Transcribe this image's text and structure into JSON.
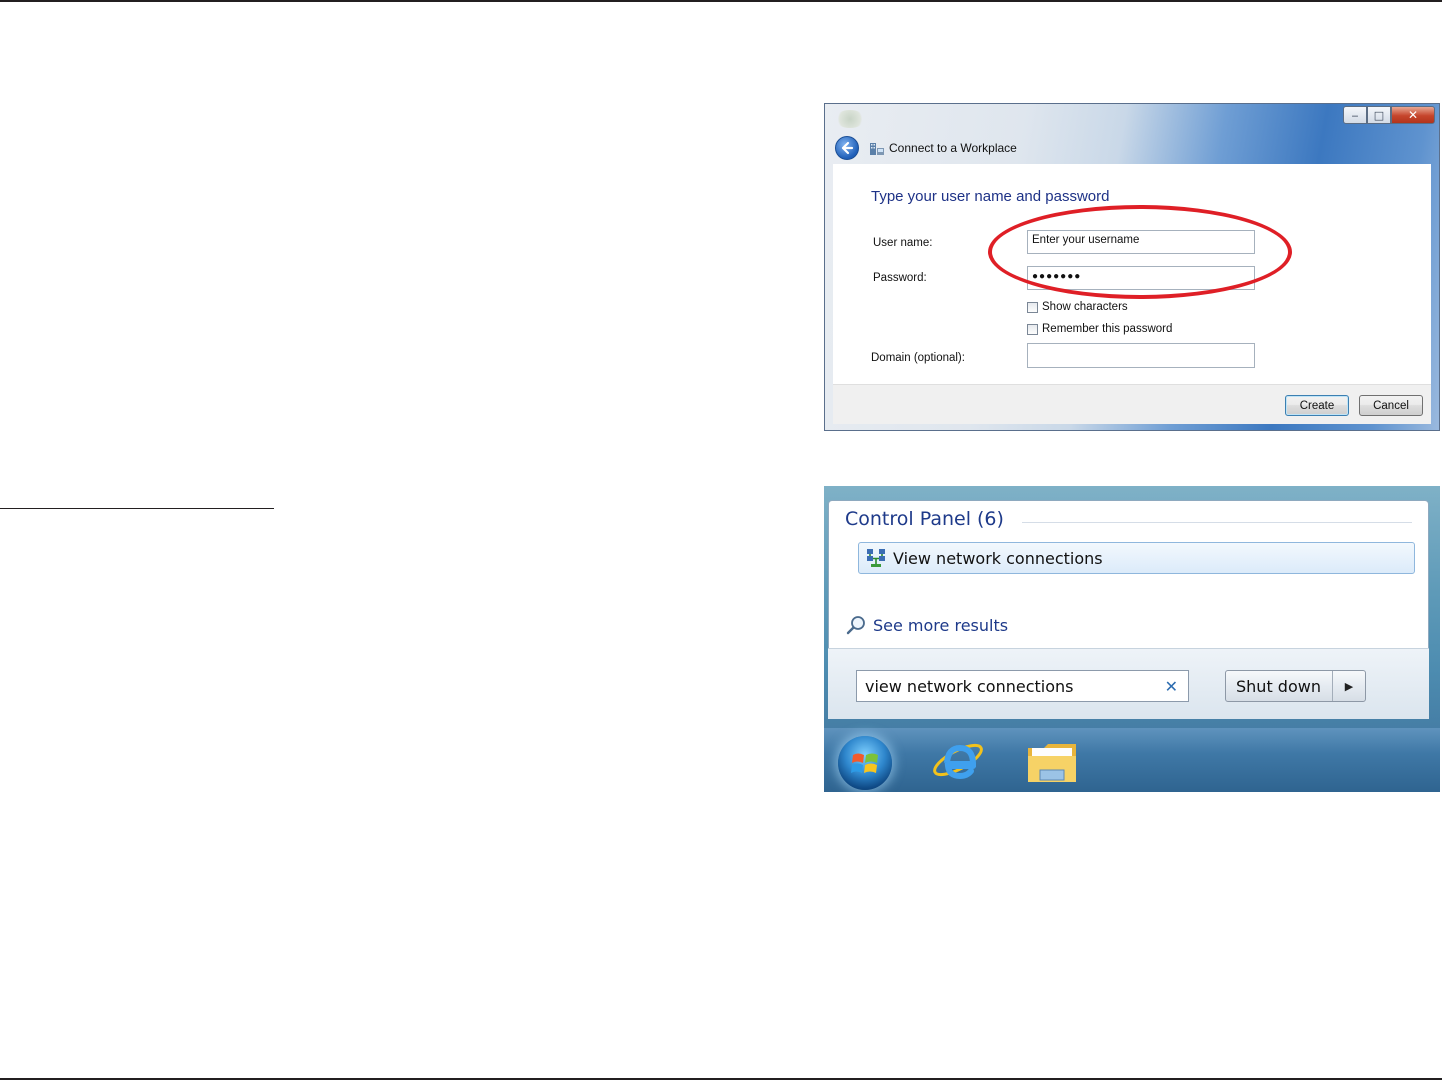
{
  "dialog": {
    "title": "Connect to a Workplace",
    "heading": "Type your user name and password",
    "username_label": "User name:",
    "username_value": "Enter your username",
    "password_label": "Password:",
    "password_value": "●●●●●●●",
    "show_characters_label": "Show characters",
    "show_characters_checked": false,
    "remember_password_label": "Remember this password",
    "remember_password_checked": false,
    "domain_label": "Domain (optional):",
    "domain_value": "",
    "create_button": "Create",
    "cancel_button": "Cancel",
    "window_buttons": {
      "minimize": "‒",
      "maximize": "□",
      "close": "✕"
    },
    "highlight_color": "#df1f26"
  },
  "start_menu": {
    "section_title": "Control Panel (6)",
    "result_label": "View network connections",
    "see_more_label": "See more results",
    "search_value": "view network connections",
    "clear_glyph": "✕",
    "shutdown_label": "Shut down",
    "shutdown_arrow": "▶",
    "taskbar_icons": [
      "start-orb-icon",
      "internet-explorer-icon",
      "windows-explorer-icon"
    ]
  }
}
